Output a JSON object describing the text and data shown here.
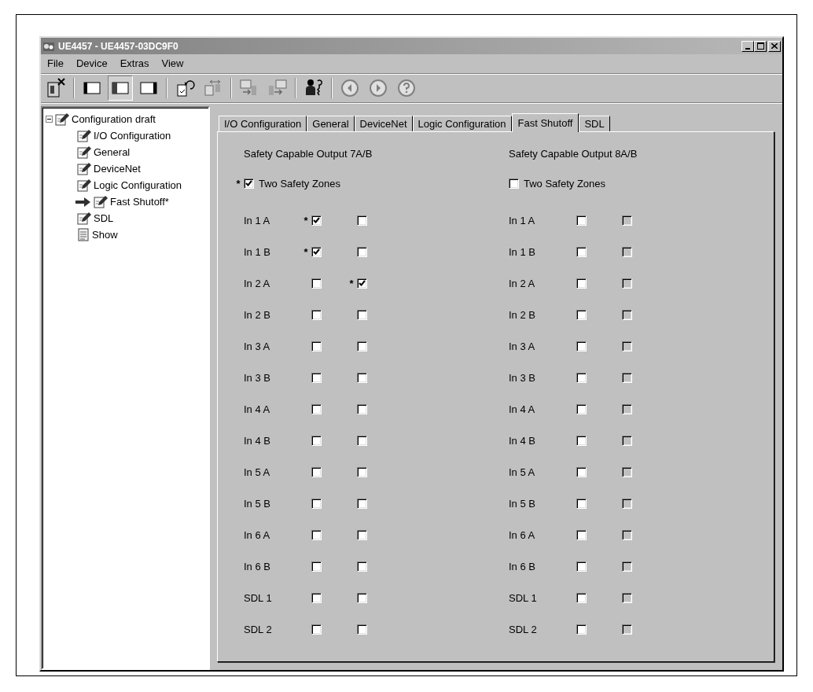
{
  "window": {
    "title": "UE4457 - UE4457-03DC9F0"
  },
  "menu": [
    "File",
    "Device",
    "Extras",
    "View"
  ],
  "toolbar": [
    [
      {
        "kind": "device-close",
        "pressed": false,
        "disabled": false
      }
    ],
    [
      {
        "kind": "layout-left",
        "pressed": false,
        "disabled": false
      },
      {
        "kind": "layout-middle",
        "pressed": true,
        "disabled": false
      },
      {
        "kind": "layout-right",
        "pressed": false,
        "disabled": false
      }
    ],
    [
      {
        "kind": "doc-undo",
        "pressed": false,
        "disabled": false
      },
      {
        "kind": "doc-compare",
        "pressed": false,
        "disabled": true
      }
    ],
    [
      {
        "kind": "transfer-to",
        "pressed": false,
        "disabled": true
      },
      {
        "kind": "transfer-from",
        "pressed": false,
        "disabled": true
      }
    ],
    [
      {
        "kind": "user-key",
        "pressed": false,
        "disabled": false
      }
    ],
    [
      {
        "kind": "back",
        "pressed": false,
        "disabled": false
      },
      {
        "kind": "forward",
        "pressed": false,
        "disabled": false
      },
      {
        "kind": "help",
        "pressed": false,
        "disabled": false
      }
    ]
  ],
  "tree": {
    "label": "Configuration draft",
    "kind": "edit",
    "expanded": true,
    "current": false,
    "children": [
      {
        "label": "I/O Configuration",
        "kind": "edit",
        "current": false
      },
      {
        "label": "General",
        "kind": "edit",
        "current": false
      },
      {
        "label": "DeviceNet",
        "kind": "edit",
        "current": false
      },
      {
        "label": "Logic Configuration",
        "kind": "edit",
        "current": false
      },
      {
        "label": "Fast Shutoff*",
        "kind": "edit",
        "current": true
      },
      {
        "label": "SDL",
        "kind": "edit",
        "current": false
      },
      {
        "label": "Show",
        "kind": "report",
        "current": false
      }
    ]
  },
  "tabs": [
    {
      "label": "I/O Configuration",
      "selected": false
    },
    {
      "label": "General",
      "selected": false
    },
    {
      "label": "DeviceNet",
      "selected": false
    },
    {
      "label": "Logic Configuration",
      "selected": false
    },
    {
      "label": "Fast Shutoff",
      "selected": true
    },
    {
      "label": "SDL",
      "selected": false
    }
  ],
  "groups": [
    {
      "title": "Safety Capable Output 7A/B",
      "zones": {
        "label": "Two Safety Zones",
        "checked": true,
        "marker": "*"
      },
      "rows": [
        {
          "label": "In 1 A",
          "boxes": [
            {
              "checked": true,
              "disabled": false,
              "marker": "*"
            },
            {
              "checked": false,
              "disabled": false
            }
          ]
        },
        {
          "label": "In 1 B",
          "boxes": [
            {
              "checked": true,
              "disabled": false,
              "marker": "*"
            },
            {
              "checked": false,
              "disabled": false
            }
          ]
        },
        {
          "label": "In 2 A",
          "boxes": [
            {
              "checked": false,
              "disabled": false
            },
            {
              "checked": true,
              "disabled": false,
              "marker": "*"
            }
          ]
        },
        {
          "label": "In 2 B",
          "boxes": [
            {
              "checked": false,
              "disabled": false
            },
            {
              "checked": false,
              "disabled": false
            }
          ]
        },
        {
          "label": "In 3 A",
          "boxes": [
            {
              "checked": false,
              "disabled": false
            },
            {
              "checked": false,
              "disabled": false
            }
          ]
        },
        {
          "label": "In 3 B",
          "boxes": [
            {
              "checked": false,
              "disabled": false
            },
            {
              "checked": false,
              "disabled": false
            }
          ]
        },
        {
          "label": "In 4 A",
          "boxes": [
            {
              "checked": false,
              "disabled": false
            },
            {
              "checked": false,
              "disabled": false
            }
          ]
        },
        {
          "label": "In 4 B",
          "boxes": [
            {
              "checked": false,
              "disabled": false
            },
            {
              "checked": false,
              "disabled": false
            }
          ]
        },
        {
          "label": "In 5 A",
          "boxes": [
            {
              "checked": false,
              "disabled": false
            },
            {
              "checked": false,
              "disabled": false
            }
          ]
        },
        {
          "label": "In 5 B",
          "boxes": [
            {
              "checked": false,
              "disabled": false
            },
            {
              "checked": false,
              "disabled": false
            }
          ]
        },
        {
          "label": "In 6 A",
          "boxes": [
            {
              "checked": false,
              "disabled": false
            },
            {
              "checked": false,
              "disabled": false
            }
          ]
        },
        {
          "label": "In 6 B",
          "boxes": [
            {
              "checked": false,
              "disabled": false
            },
            {
              "checked": false,
              "disabled": false
            }
          ]
        },
        {
          "label": "SDL 1",
          "boxes": [
            {
              "checked": false,
              "disabled": false
            },
            {
              "checked": false,
              "disabled": false
            }
          ]
        },
        {
          "label": "SDL 2",
          "boxes": [
            {
              "checked": false,
              "disabled": false
            },
            {
              "checked": false,
              "disabled": false
            }
          ]
        }
      ]
    },
    {
      "title": "Safety Capable Output 8A/B",
      "zones": {
        "label": "Two Safety Zones",
        "checked": false
      },
      "rows": [
        {
          "label": "In 1 A",
          "boxes": [
            {
              "checked": false,
              "disabled": false
            },
            {
              "checked": false,
              "disabled": true
            }
          ]
        },
        {
          "label": "In 1 B",
          "boxes": [
            {
              "checked": false,
              "disabled": false
            },
            {
              "checked": false,
              "disabled": true
            }
          ]
        },
        {
          "label": "In 2 A",
          "boxes": [
            {
              "checked": false,
              "disabled": false
            },
            {
              "checked": false,
              "disabled": true
            }
          ]
        },
        {
          "label": "In 2 B",
          "boxes": [
            {
              "checked": false,
              "disabled": false
            },
            {
              "checked": false,
              "disabled": true
            }
          ]
        },
        {
          "label": "In 3 A",
          "boxes": [
            {
              "checked": false,
              "disabled": false
            },
            {
              "checked": false,
              "disabled": true
            }
          ]
        },
        {
          "label": "In 3 B",
          "boxes": [
            {
              "checked": false,
              "disabled": false
            },
            {
              "checked": false,
              "disabled": true
            }
          ]
        },
        {
          "label": "In 4 A",
          "boxes": [
            {
              "checked": false,
              "disabled": false
            },
            {
              "checked": false,
              "disabled": true
            }
          ]
        },
        {
          "label": "In 4 B",
          "boxes": [
            {
              "checked": false,
              "disabled": false
            },
            {
              "checked": false,
              "disabled": true
            }
          ]
        },
        {
          "label": "In 5 A",
          "boxes": [
            {
              "checked": false,
              "disabled": false
            },
            {
              "checked": false,
              "disabled": true
            }
          ]
        },
        {
          "label": "In 5 B",
          "boxes": [
            {
              "checked": false,
              "disabled": false
            },
            {
              "checked": false,
              "disabled": true
            }
          ]
        },
        {
          "label": "In 6 A",
          "boxes": [
            {
              "checked": false,
              "disabled": false
            },
            {
              "checked": false,
              "disabled": true
            }
          ]
        },
        {
          "label": "In 6 B",
          "boxes": [
            {
              "checked": false,
              "disabled": false
            },
            {
              "checked": false,
              "disabled": true
            }
          ]
        },
        {
          "label": "SDL 1",
          "boxes": [
            {
              "checked": false,
              "disabled": false
            },
            {
              "checked": false,
              "disabled": true
            }
          ]
        },
        {
          "label": "SDL 2",
          "boxes": [
            {
              "checked": false,
              "disabled": false
            },
            {
              "checked": false,
              "disabled": true
            }
          ]
        }
      ]
    }
  ]
}
